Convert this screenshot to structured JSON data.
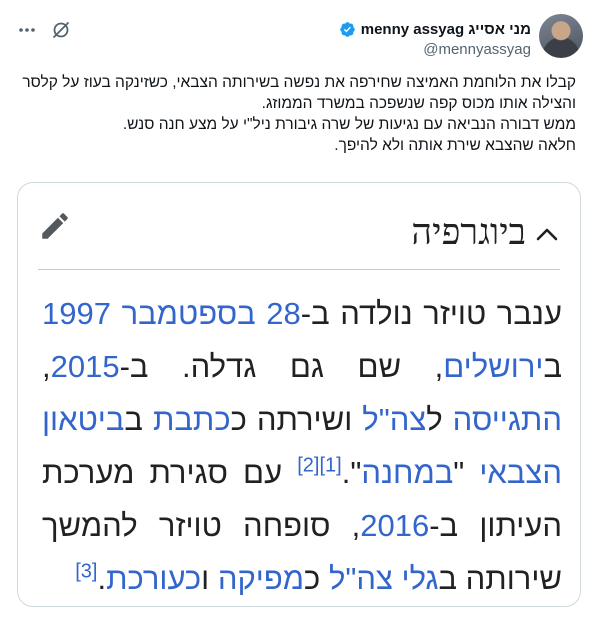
{
  "tweet": {
    "display_name": "menny assyag מני אסייג",
    "handle": "@mennyassyag",
    "text_lines": [
      "קבלו את הלוחמת האמיצה שחירפה את נפשה בשירותה הצבאי, כשזינקה בעוז על קלסר והצילה אותו מכוס קפה שנשפכה במשרד הממוזג.",
      "ממש דבורה הנביאה עם נגיעות של שרה גיבורת ניל\"י על מצע חנה סנש.",
      "חלאה שהצבא שירת אותה ולא להיפך."
    ]
  },
  "wiki": {
    "title": "ביוגרפיה",
    "segments": [
      {
        "t": "ענבר טויזר נולדה ב-",
        "link": false
      },
      {
        "t": "28 בספטמבר",
        "link": true
      },
      {
        "t": " ",
        "link": false
      },
      {
        "t": "1997",
        "link": true
      },
      {
        "t": " ב",
        "link": false
      },
      {
        "t": "ירושלים",
        "link": true
      },
      {
        "t": ", שם גם גדלה. ב-",
        "link": false
      },
      {
        "t": "2015",
        "link": true
      },
      {
        "t": ", ",
        "link": false
      },
      {
        "t": "התגייסה",
        "link": true
      },
      {
        "t": " ל",
        "link": false
      },
      {
        "t": "צה\"ל",
        "link": true
      },
      {
        "t": " ושירתה ",
        "link": false
      },
      {
        "t": "כ",
        "link": false
      },
      {
        "t": "כתבת",
        "link": true
      },
      {
        "t": " ב",
        "link": false
      },
      {
        "t": "ביטאון",
        "link": true
      },
      {
        "t": " ",
        "link": false
      },
      {
        "t": "הצבאי",
        "link": true
      },
      {
        "t": " \"",
        "link": false
      },
      {
        "t": "במחנה",
        "link": true
      },
      {
        "t": "\".",
        "link": false
      },
      {
        "t": "[1]",
        "link": true,
        "sup": true
      },
      {
        "t": "[2]",
        "link": true,
        "sup": true
      },
      {
        "t": " עם סגירת מערכת העיתון ב-",
        "link": false
      },
      {
        "t": "2016",
        "link": true
      },
      {
        "t": ", סופחה טויזר להמשך שירותה ב",
        "link": false
      },
      {
        "t": "גלי צה\"ל",
        "link": true
      },
      {
        "t": " כ",
        "link": false
      },
      {
        "t": "מפיקה",
        "link": true
      },
      {
        "t": " ו",
        "link": false
      },
      {
        "t": "כעורכת",
        "link": true
      },
      {
        "t": ".",
        "link": false
      },
      {
        "t": "[3]",
        "link": true,
        "sup": true
      }
    ]
  },
  "icons": {
    "verified": "verified-badge-icon",
    "grok": "grok-icon",
    "more": "more-icon",
    "chevron": "chevron-up-icon",
    "edit": "pencil-icon"
  },
  "colors": {
    "verified": "#1d9bf0",
    "wiki_link": "#3366cc",
    "secondary": "#536471"
  }
}
